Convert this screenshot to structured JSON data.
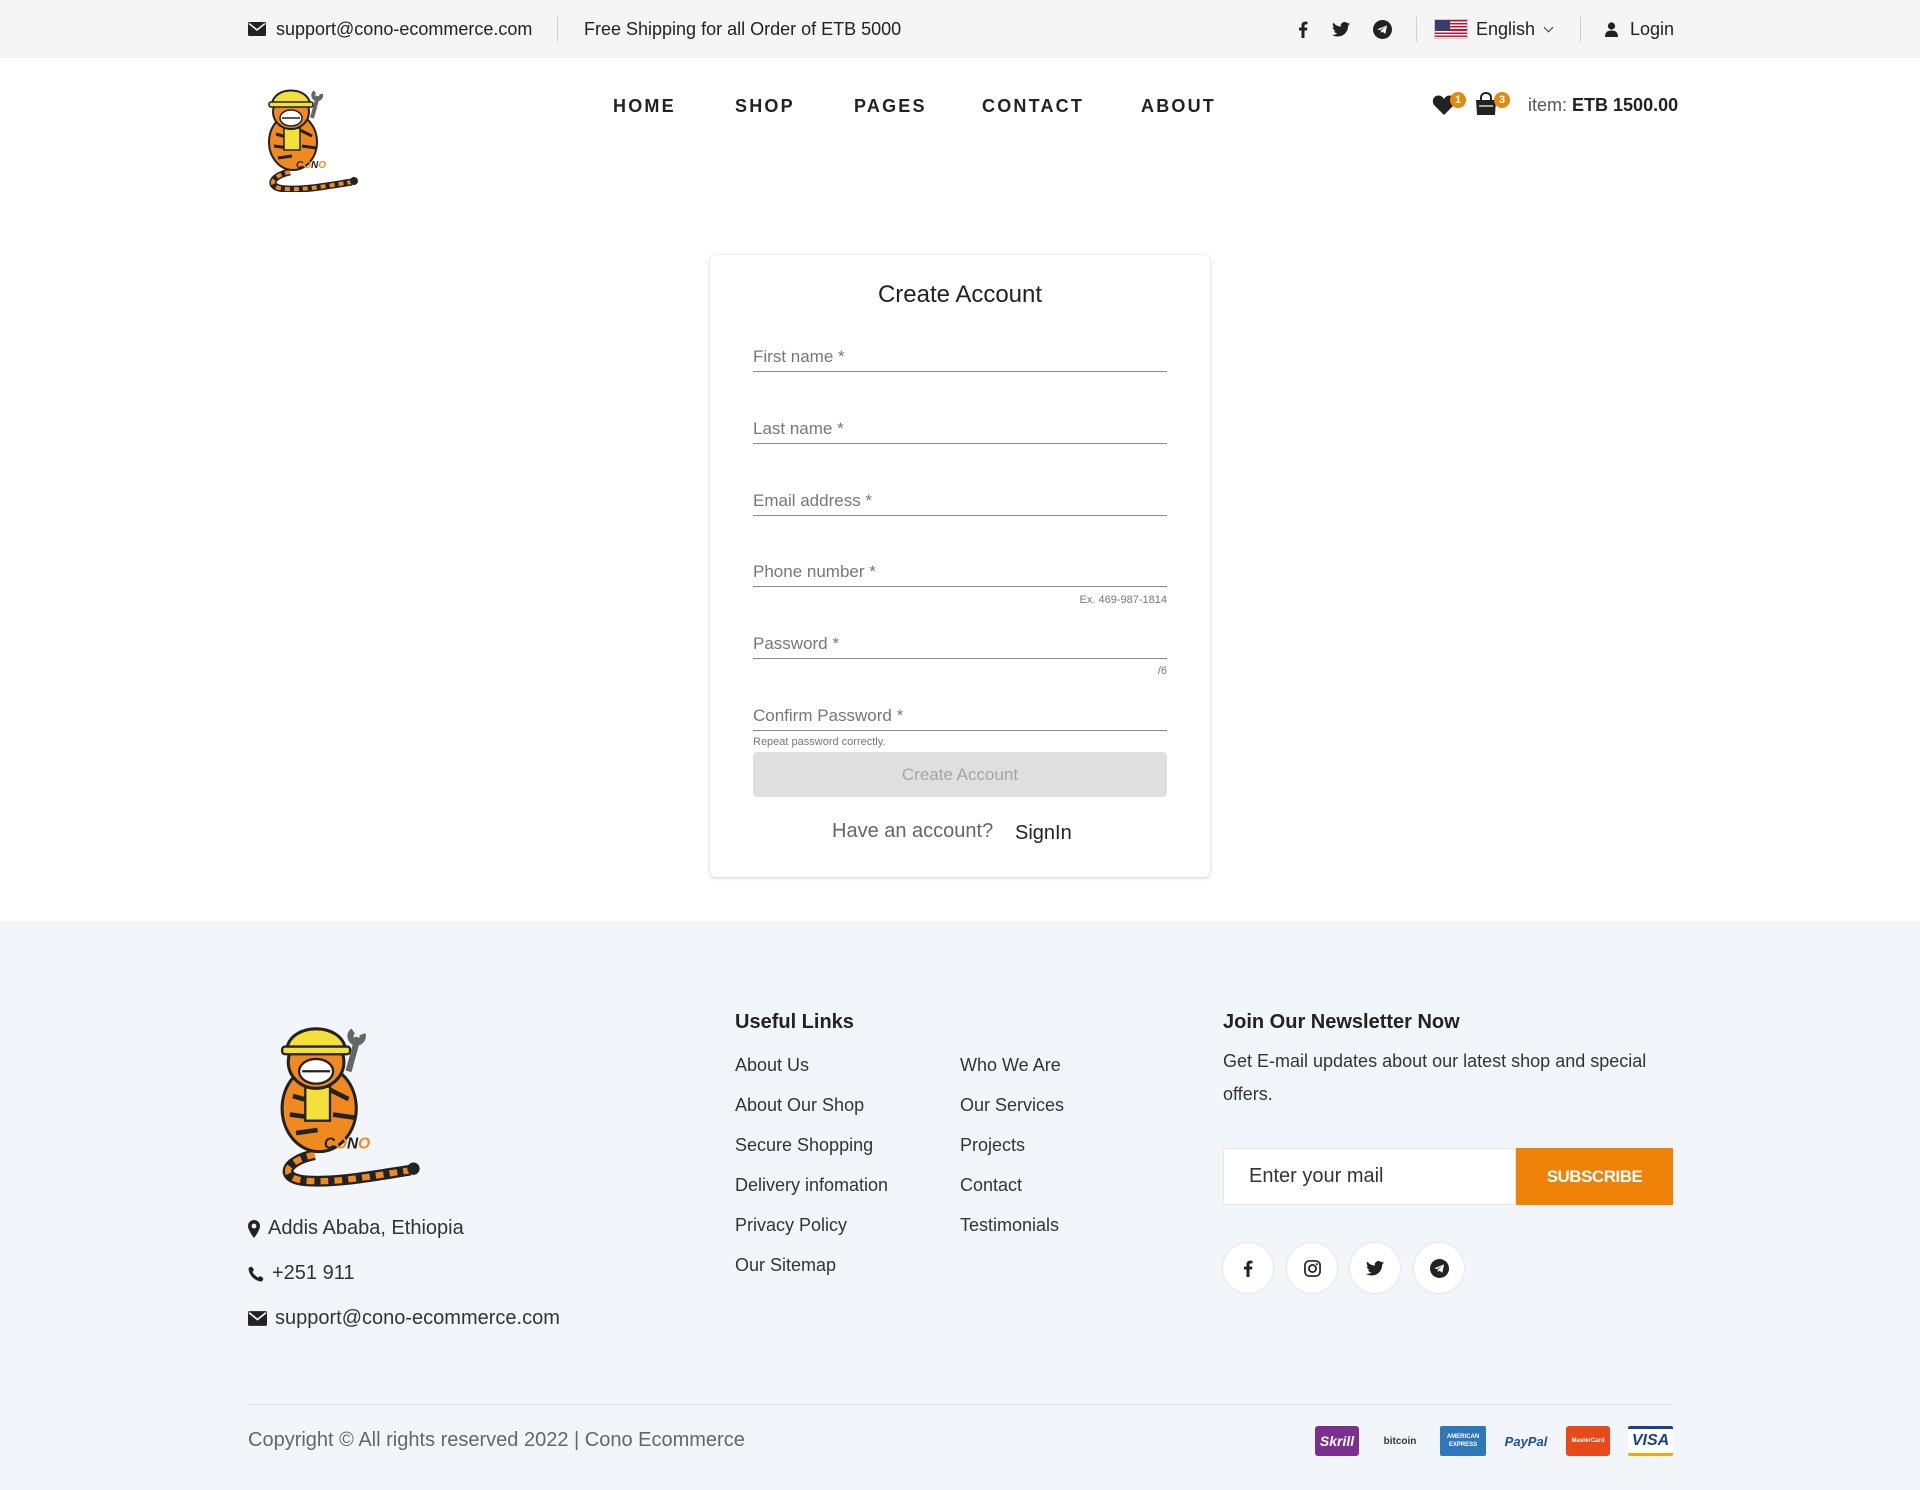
{
  "topbar": {
    "email": "support@cono-ecommerce.com",
    "shipping": "Free Shipping for all Order of ETB 5000",
    "social_icons": [
      "facebook-icon",
      "twitter-icon",
      "telegram-icon"
    ],
    "language": "English",
    "login": "Login"
  },
  "nav": {
    "items": [
      "HOME",
      "SHOP",
      "PAGES",
      "CONTACT",
      "ABOUT"
    ]
  },
  "header": {
    "logo_text": "CONO",
    "wishlist_count": "1",
    "cart_count": "3",
    "item_label": "item:",
    "item_total": "ETB 1500.00"
  },
  "form": {
    "title": "Create Account",
    "first_name_placeholder": "First name *",
    "last_name_placeholder": "Last name *",
    "email_placeholder": "Email address *",
    "phone_placeholder": "Phone number *",
    "phone_hint": "Ex. 469-987-1814",
    "password_placeholder": "Password *",
    "password_counter": "/6",
    "confirm_placeholder": "Confirm Password *",
    "confirm_hint": "Repeat password correctly.",
    "submit": "Create Account",
    "have_account": "Have an account?",
    "signin": "SignIn"
  },
  "footer": {
    "address": "Addis Ababa, Ethiopia",
    "phone": "+251 911",
    "email": "support@cono-ecommerce.com",
    "useful_links_title": "Useful Links",
    "links_col1": [
      "About Us",
      "About Our Shop",
      "Secure Shopping",
      "Delivery infomation",
      "Privacy Policy",
      "Our Sitemap"
    ],
    "links_col2": [
      "Who We Are",
      "Our Services",
      "Projects",
      "Contact",
      "Testimonials"
    ],
    "newsletter_title": "Join Our Newsletter Now",
    "newsletter_text": "Get E-mail updates about our latest shop and special offers.",
    "mail_placeholder": "Enter your mail",
    "subscribe": "SUBSCRIBE",
    "social_icons": [
      "facebook-icon",
      "instagram-icon",
      "twitter-icon",
      "telegram-icon"
    ],
    "copyright": "Copyright © All rights reserved 2022 | Cono Ecommerce",
    "payments": [
      "Skrill",
      "bitcoin",
      "AMERICAN EXPRESS",
      "PayPal",
      "MasterCard",
      "VISA"
    ]
  },
  "colors": {
    "accent": "#ef8207",
    "badge": "#e8870d",
    "topbar_bg": "#f5f5f5",
    "footer_bg": "#f2f5fa"
  }
}
